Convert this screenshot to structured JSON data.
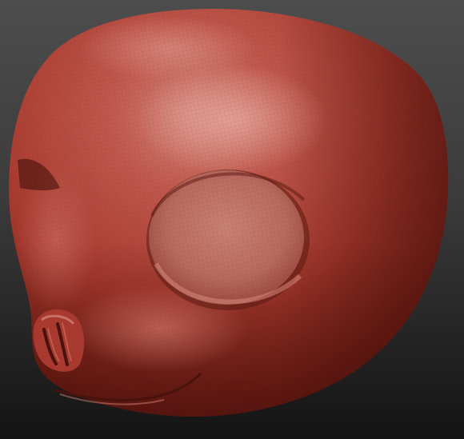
{
  "scene": {
    "model_name": "sculpted-head-mesh",
    "material_color": "#b0453a",
    "highlight_color": "#d88a80",
    "shadow_color": "#4a120d",
    "background_top_color": "#4d4d4d",
    "background_bottom_color": "#141414",
    "wireframe_visible": true
  }
}
